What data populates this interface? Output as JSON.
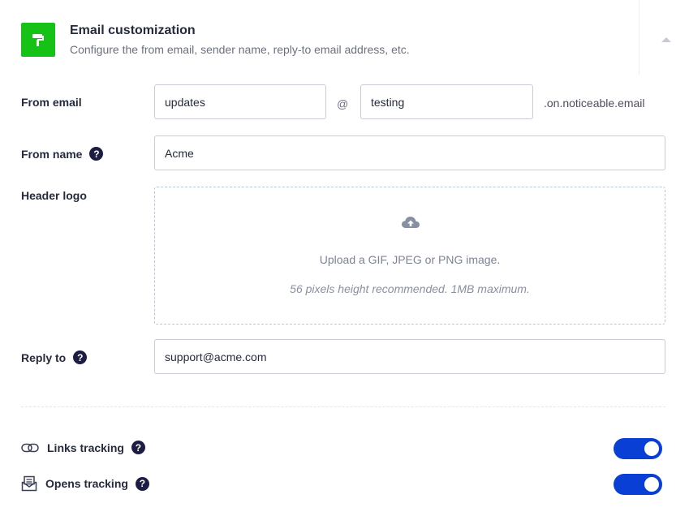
{
  "header": {
    "title": "Email customization",
    "subtitle": "Configure the from email, sender name, reply-to email address, etc.",
    "icon": "paint-roller-icon",
    "icon_color": "#17c217"
  },
  "form": {
    "from_email": {
      "label": "From email",
      "local_part": "updates",
      "at": "@",
      "subdomain": "testing",
      "domain_suffix": ".on.noticeable.email"
    },
    "from_name": {
      "label": "From name",
      "value": "Acme",
      "help": "?"
    },
    "header_logo": {
      "label": "Header logo",
      "upload_text": "Upload a GIF, JPEG or PNG image.",
      "hint": "56 pixels height recommended. 1MB maximum."
    },
    "reply_to": {
      "label": "Reply to",
      "value": "support@acme.com",
      "help": "?"
    }
  },
  "tracking": {
    "links": {
      "label": "Links tracking",
      "help": "?",
      "enabled": true
    },
    "opens": {
      "label": "Opens tracking",
      "help": "?",
      "enabled": true
    }
  },
  "colors": {
    "accent": "#0a3fd6",
    "help_bg": "#1d1d44"
  }
}
